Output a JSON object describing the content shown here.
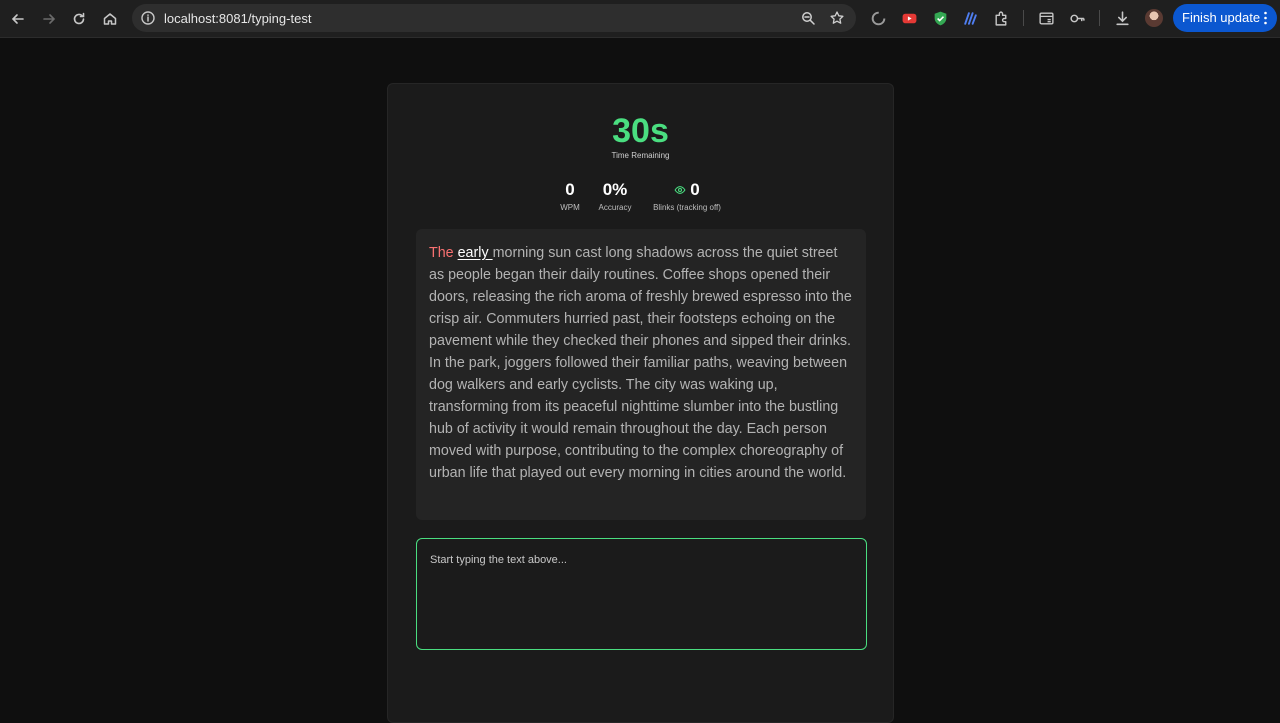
{
  "browser": {
    "url": "localhost:8081/typing-test",
    "finish_update_label": "Finish update"
  },
  "colors": {
    "accent": "#4ade80",
    "typed": "#f87171",
    "update_button": "#0b57d0"
  },
  "timer": {
    "value": "30s",
    "label": "Time Remaining"
  },
  "stats": {
    "wpm": {
      "value": "0",
      "label": "WPM"
    },
    "accuracy": {
      "value": "0%",
      "label": "Accuracy"
    },
    "blinks": {
      "value": "0",
      "label": "Blinks (tracking off)",
      "icon": "eye-icon"
    }
  },
  "passage": {
    "typed": "The ",
    "current": "early ",
    "remaining": "morning sun cast long shadows across the quiet street as people began their daily routines. Coffee shops opened their doors, releasing the rich aroma of freshly brewed espresso into the crisp air. Commuters hurried past, their footsteps echoing on the pavement while they checked their phones and sipped their drinks. In the park, joggers followed their familiar paths, weaving between dog walkers and early cyclists. The city was waking up, transforming from its peaceful nighttime slumber into the bustling hub of activity it would remain throughout the day. Each person moved with purpose, contributing to the complex choreography of urban life that played out every morning in cities around the world."
  },
  "input": {
    "placeholder": "Start typing the text above...",
    "value": ""
  }
}
